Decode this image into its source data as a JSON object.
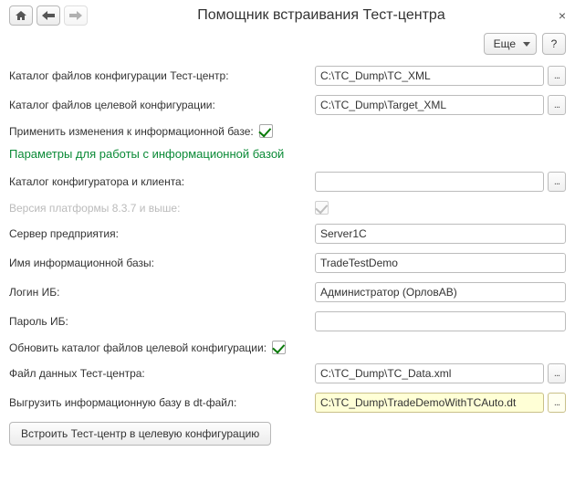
{
  "title": "Помощник встраивания Тест-центра",
  "toolbar": {
    "more_label": "Еще",
    "help_label": "?"
  },
  "fields": {
    "tc_cfg_dir": {
      "label": "Каталог файлов конфигурации Тест-центр:",
      "value": "C:\\TC_Dump\\TC_XML"
    },
    "target_cfg_dir": {
      "label": "Каталог файлов целевой конфигурации:",
      "value": "C:\\TC_Dump\\Target_XML"
    },
    "apply_to_ib": {
      "label": "Применить изменения к информационной базе:",
      "checked": true
    },
    "section": "Параметры для работы с информационной базой",
    "cfg_client_dir": {
      "label": "Каталог конфигуратора и клиента:",
      "value": ""
    },
    "platform_ver": {
      "label": "Версия платформы 8.3.7 и выше:",
      "checked": true
    },
    "server": {
      "label": "Сервер предприятия:",
      "value": "Server1C"
    },
    "ib_name": {
      "label": "Имя информационной базы:",
      "value": "TradeTestDemo"
    },
    "login": {
      "label": "Логин ИБ:",
      "value": "Администратор (ОрловАВ)"
    },
    "password": {
      "label": "Пароль ИБ:",
      "value": ""
    },
    "update_target_dir": {
      "label": "Обновить каталог файлов целевой конфигурации:",
      "checked": true
    },
    "tc_data_file": {
      "label": "Файл данных Тест-центра:",
      "value": "C:\\TC_Dump\\TC_Data.xml"
    },
    "dump_dt": {
      "label": "Выгрузить информационную базу в dt-файл:",
      "value": "C:\\TC_Dump\\TradeDemoWithTCAuto.dt"
    }
  },
  "actions": {
    "embed_label": "Встроить Тест-центр в целевую конфигурацию"
  },
  "icons": {
    "picker": "..."
  }
}
